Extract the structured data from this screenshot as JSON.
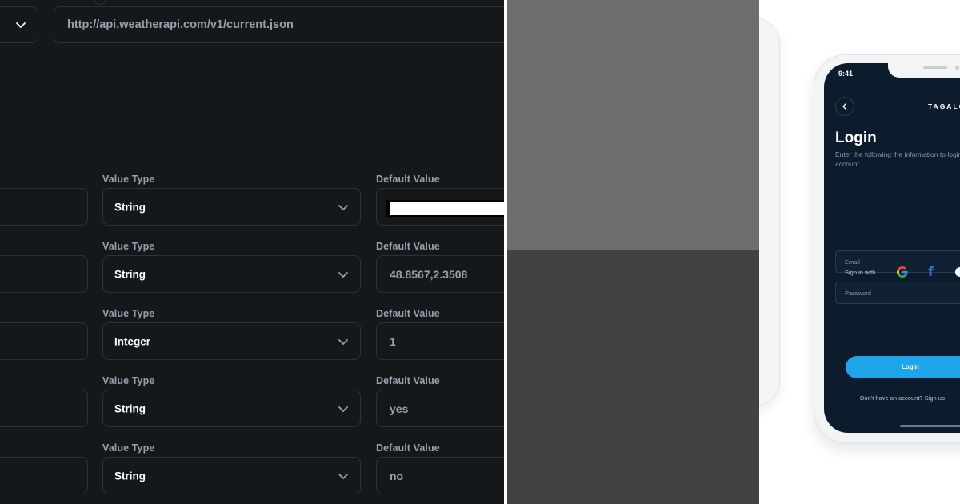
{
  "endpoint": {
    "url": "http://api.weatherapi.com/v1/current.json"
  },
  "variables": [
    {
      "value_type_label": "Value Type",
      "value_type": "String",
      "default_label": "Default Value",
      "default_value": ""
    },
    {
      "value_type_label": "Value Type",
      "value_type": "String",
      "default_label": "Default Value",
      "default_value": "48.8567,2.3508"
    },
    {
      "value_type_label": "Value Type",
      "value_type": "Integer",
      "default_label": "Default Value",
      "default_value": "1"
    },
    {
      "value_type_label": "Value Type",
      "value_type": "String",
      "default_label": "Default Value",
      "default_value": "yes"
    },
    {
      "value_type_label": "Value Type",
      "value_type": "String",
      "default_label": "Default Value",
      "default_value": "no"
    }
  ],
  "phone": {
    "status_time": "9:41",
    "brand": "TAGALOG",
    "title": "Login",
    "subtitle": "Enter the following the information to login into your account.",
    "email_placeholder": "Email",
    "password_placeholder": "Password",
    "sign_in_with": "Sign in with",
    "login_button": "Login",
    "footer": "Don't have an account? Sign up"
  },
  "colors": {
    "editor_bg": "#14181b",
    "editor_border": "#2b3339",
    "label_text": "#95a1ac",
    "phone_screen_bg": "#0c1c2c",
    "login_button": "#1fa4ea",
    "mid_top": "#6d6d6d",
    "mid_bottom": "#424242"
  },
  "icons": [
    "chevron-down-icon",
    "back-arrow-icon",
    "google-icon",
    "facebook-icon",
    "apple-icon"
  ]
}
